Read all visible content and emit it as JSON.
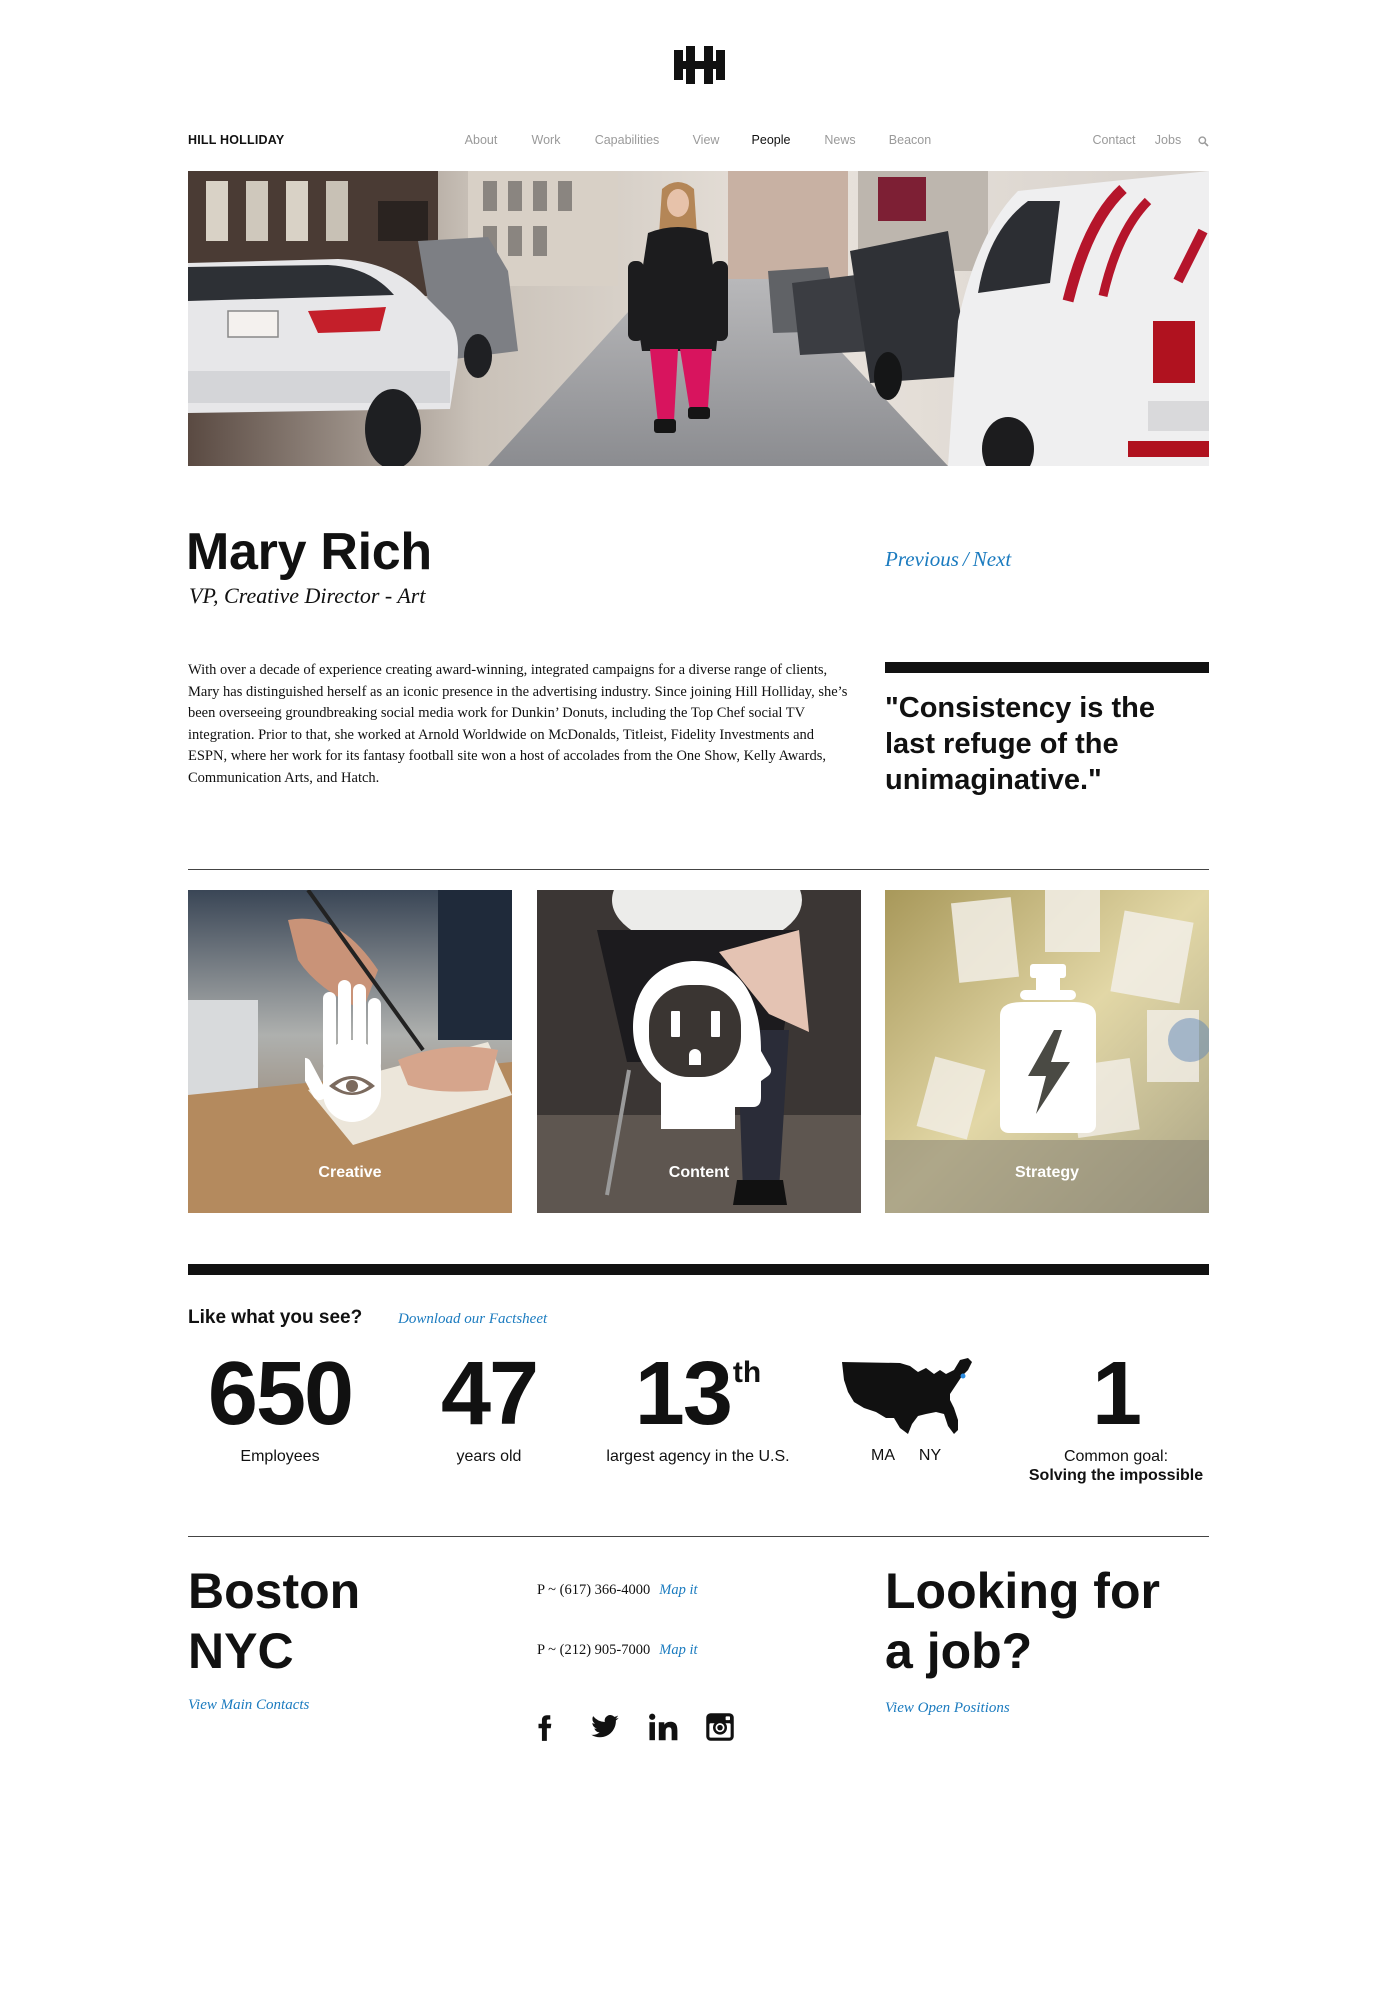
{
  "logo": {
    "icon": "hh-logo-icon"
  },
  "brand": {
    "name": "HILL HOLLIDAY"
  },
  "nav": {
    "items": [
      {
        "label": "About"
      },
      {
        "label": "Work"
      },
      {
        "label": "Capabilities"
      },
      {
        "label": "View"
      },
      {
        "label": "People",
        "active": true
      },
      {
        "label": "News"
      },
      {
        "label": "Beacon"
      }
    ],
    "utility": [
      {
        "label": "Contact"
      },
      {
        "label": "Jobs"
      }
    ],
    "search_icon": "search-icon"
  },
  "profile": {
    "name": "Mary Rich",
    "title": "VP, Creative Director - Art",
    "bio": "With over a decade of experience creating award-winning, integrated campaigns for a diverse range of clients, Mary has distinguished herself as an iconic presence in the advertising industry. Since joining Hill Holliday, she’s been overseeing groundbreaking social media work for Dunkin’ Donuts, including the Top Chef social TV integration. Prior to that, she worked at Arnold Worldwide on McDonalds, Titleist, Fidelity Investments and ESPN, where her work for its fantasy football site won a host of accolades from the One Show, Kelly Awards, Communication Arts, and Hatch.",
    "quote": "\"Consistency is the last refuge of the unimaginative.\""
  },
  "pager": {
    "previous": "Previous",
    "separator": "/",
    "next": "Next"
  },
  "capabilities": [
    {
      "label": "Creative",
      "icon": "hand-eye-icon"
    },
    {
      "label": "Content",
      "icon": "head-outlet-icon"
    },
    {
      "label": "Strategy",
      "icon": "bottle-lightning-icon"
    }
  ],
  "factsheet": {
    "heading": "Like what you see?",
    "link": "Download our Factsheet"
  },
  "stats": {
    "employees": {
      "value": "650",
      "label": "Employees"
    },
    "age": {
      "value": "47",
      "label": "years old"
    },
    "rank": {
      "value": "13",
      "suffix": "th",
      "label": "largest agency in the U.S."
    },
    "offices": {
      "icon": "us-map-icon",
      "labels": [
        "MA",
        "NY"
      ]
    },
    "goal": {
      "value": "1",
      "label": "Common goal:",
      "detail": "Solving the impossible"
    }
  },
  "footer": {
    "cities": [
      "Boston",
      "NYC"
    ],
    "contacts_link": "View Main Contacts",
    "phones": [
      {
        "number": "P ~ (617) 366-4000",
        "map": "Map it"
      },
      {
        "number": "P ~ (212) 905-7000",
        "map": "Map it"
      }
    ],
    "social": [
      {
        "icon": "facebook-icon"
      },
      {
        "icon": "twitter-icon"
      },
      {
        "icon": "linkedin-icon"
      },
      {
        "icon": "instagram-icon"
      }
    ],
    "jobs": {
      "heading": "Looking for a job?",
      "link": "View Open Positions"
    }
  },
  "colors": {
    "link": "#1b7bbf",
    "text": "#111111",
    "nav_inactive": "#9a9a9a"
  }
}
